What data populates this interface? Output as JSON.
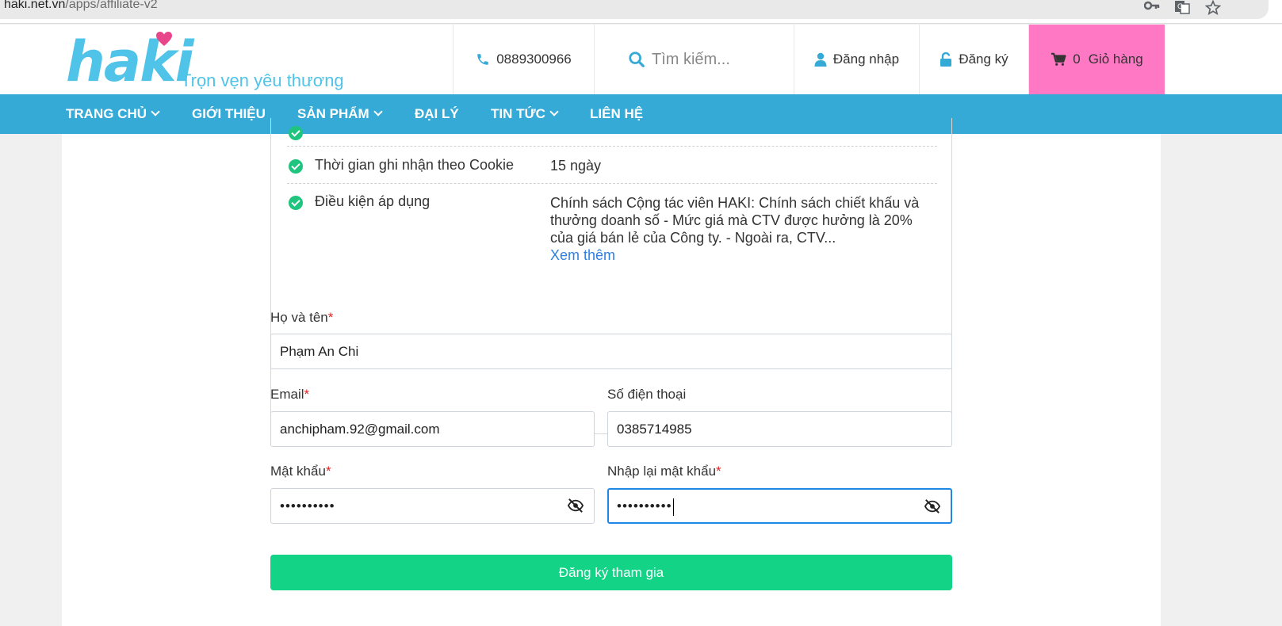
{
  "browser": {
    "domain": "haki.net.vn",
    "path": "/apps/affiliate-v2"
  },
  "header": {
    "logo_text": "haki",
    "tagline": "Trọn vẹn yêu thương",
    "phone": "0889300966",
    "search_placeholder": "Tìm kiếm...",
    "login": "Đăng nhập",
    "register": "Đăng ký",
    "cart_count": "0",
    "cart_label": "Giỏ hàng"
  },
  "nav": {
    "items": [
      {
        "label": "TRANG CHỦ",
        "dropdown": true
      },
      {
        "label": "GIỚI THIỆU",
        "dropdown": false
      },
      {
        "label": "SẢN PHẨM",
        "dropdown": true
      },
      {
        "label": "ĐẠI LÝ",
        "dropdown": false
      },
      {
        "label": "TIN TỨC",
        "dropdown": true
      },
      {
        "label": "LIÊN HỆ",
        "dropdown": false
      }
    ]
  },
  "program": {
    "rows": [
      {
        "label": "Thời gian ghi nhận theo Cookie",
        "value": "15 ngày"
      },
      {
        "label": "Điều kiện áp dụng",
        "value_lines": [
          "Chính sách Cộng tác viên HAKI: Chính sách chiết khấu và",
          "thưởng doanh số - Mức giá mà CTV được hưởng là 20%",
          "của giá bán lẻ của Công ty. - Ngoài ra, CTV..."
        ],
        "more": "Xem thêm"
      }
    ]
  },
  "form": {
    "fullname_label": "Họ và tên",
    "fullname_value": "Phạm An Chi",
    "email_label": "Email",
    "email_value": "anchipham.92@gmail.com",
    "phone_label": "Số điện thoại",
    "phone_value": "0385714985",
    "password_label": "Mật khẩu",
    "password_value": "••••••••••",
    "confirm_label": "Nhập lại mật khẩu",
    "confirm_value": "••••••••••",
    "required_mark": "*",
    "submit_label": "Đăng ký tham gia"
  },
  "colors": {
    "brand": "#4fc3e8",
    "nav": "#35aad6",
    "cart": "#ff78c4",
    "submit": "#13d386",
    "check": "#1fc47e",
    "link": "#2f7fe0"
  }
}
